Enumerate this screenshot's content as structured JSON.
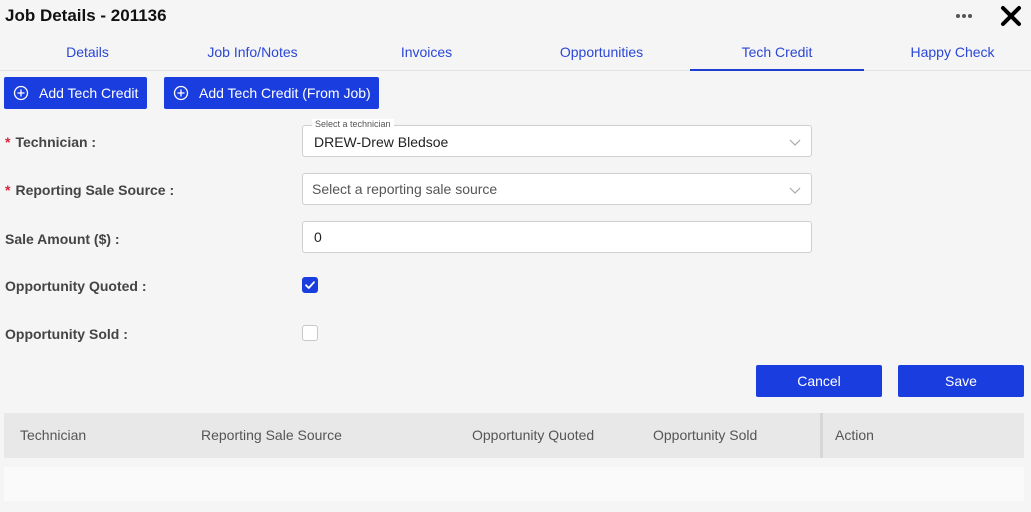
{
  "header": {
    "title": "Job Details - 201136",
    "icons": [
      "more-horizontal-icon",
      "close-icon"
    ]
  },
  "tabs": [
    {
      "label": "Details",
      "active": false
    },
    {
      "label": "Job Info/Notes",
      "active": false
    },
    {
      "label": "Invoices",
      "active": false
    },
    {
      "label": "Opportunities",
      "active": false
    },
    {
      "label": "Tech Credit",
      "active": true
    },
    {
      "label": "Happy Check",
      "active": false
    }
  ],
  "actions": {
    "add_tech_credit": "Add Tech Credit",
    "add_tech_credit_from_job": "Add Tech Credit (From Job)"
  },
  "form": {
    "required_mark": "*",
    "technician": {
      "label": "Technician :",
      "float_label": "Select a technician",
      "value": "DREW-Drew Bledsoe"
    },
    "reporting_sale_source": {
      "label": "Reporting Sale Source :",
      "placeholder": "Select a reporting sale source"
    },
    "sale_amount": {
      "label": "Sale Amount ($) :",
      "value": "0"
    },
    "opportunity_quoted": {
      "label": "Opportunity Quoted :",
      "checked": true
    },
    "opportunity_sold": {
      "label": "Opportunity Sold :",
      "checked": false
    },
    "cancel_label": "Cancel",
    "save_label": "Save"
  },
  "table": {
    "columns": [
      "Technician",
      "Reporting Sale Source",
      "Opportunity Quoted",
      "Opportunity Sold",
      "Action"
    ],
    "rows": []
  },
  "colors": {
    "primary": "#1a3de0",
    "tab_text": "#2b47d6",
    "required": "#d9263b"
  }
}
